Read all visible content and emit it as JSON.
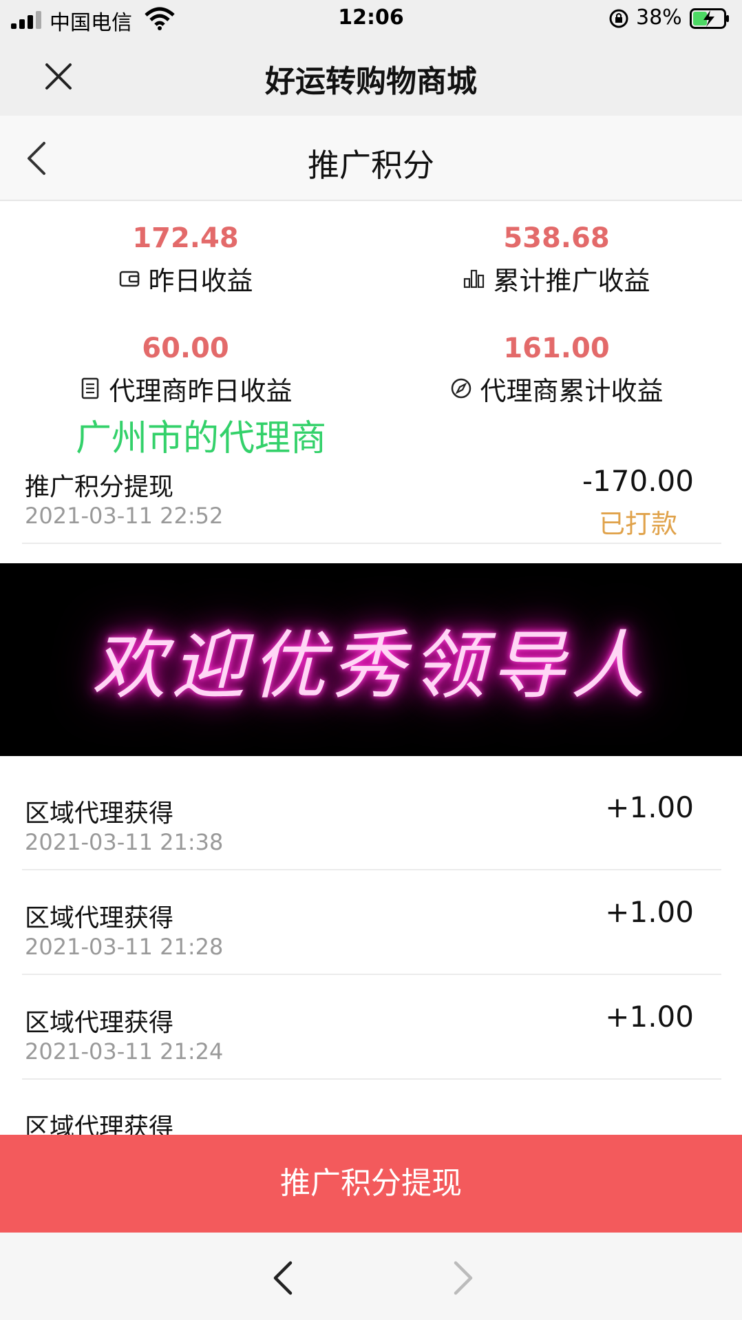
{
  "status_bar": {
    "carrier": "中国电信",
    "time": "12:06",
    "battery_percent": "38%"
  },
  "app_bar": {
    "title": "好运转购物商城",
    "close_icon": "close-icon"
  },
  "page_header": {
    "title": "推广积分",
    "back_icon": "chevron-left-icon"
  },
  "stats": [
    {
      "value": "172.48",
      "label": "昨日收益",
      "icon": "wallet-icon"
    },
    {
      "value": "538.68",
      "label": "累计推广收益",
      "icon": "bar-chart-icon"
    },
    {
      "value": "60.00",
      "label": "代理商昨日收益",
      "icon": "document-icon"
    },
    {
      "value": "161.00",
      "label": "代理商累计收益",
      "icon": "compass-icon"
    }
  ],
  "agent_note": "广州市的代理商",
  "banner_text": "欢迎优秀领导人",
  "records": [
    {
      "title": "推广积分提现",
      "date": "2021-03-11 22:52",
      "amount": "-170.00",
      "status": "已打款"
    },
    {
      "title": "区域代理获得",
      "date": "2021-03-11 21:38",
      "amount": "+1.00"
    },
    {
      "title": "区域代理获得",
      "date": "2021-03-11 21:28",
      "amount": "+1.00"
    },
    {
      "title": "区域代理获得",
      "date": "2021-03-11 21:24",
      "amount": "+1.00"
    },
    {
      "title": "区域代理获得",
      "date": "",
      "amount": ""
    }
  ],
  "withdraw_button": "推广积分提现",
  "colors": {
    "stat_value": "#e36a6a",
    "status_paid": "#e0a24a",
    "agent_note": "#33d16a",
    "button": "#f35a5c"
  }
}
